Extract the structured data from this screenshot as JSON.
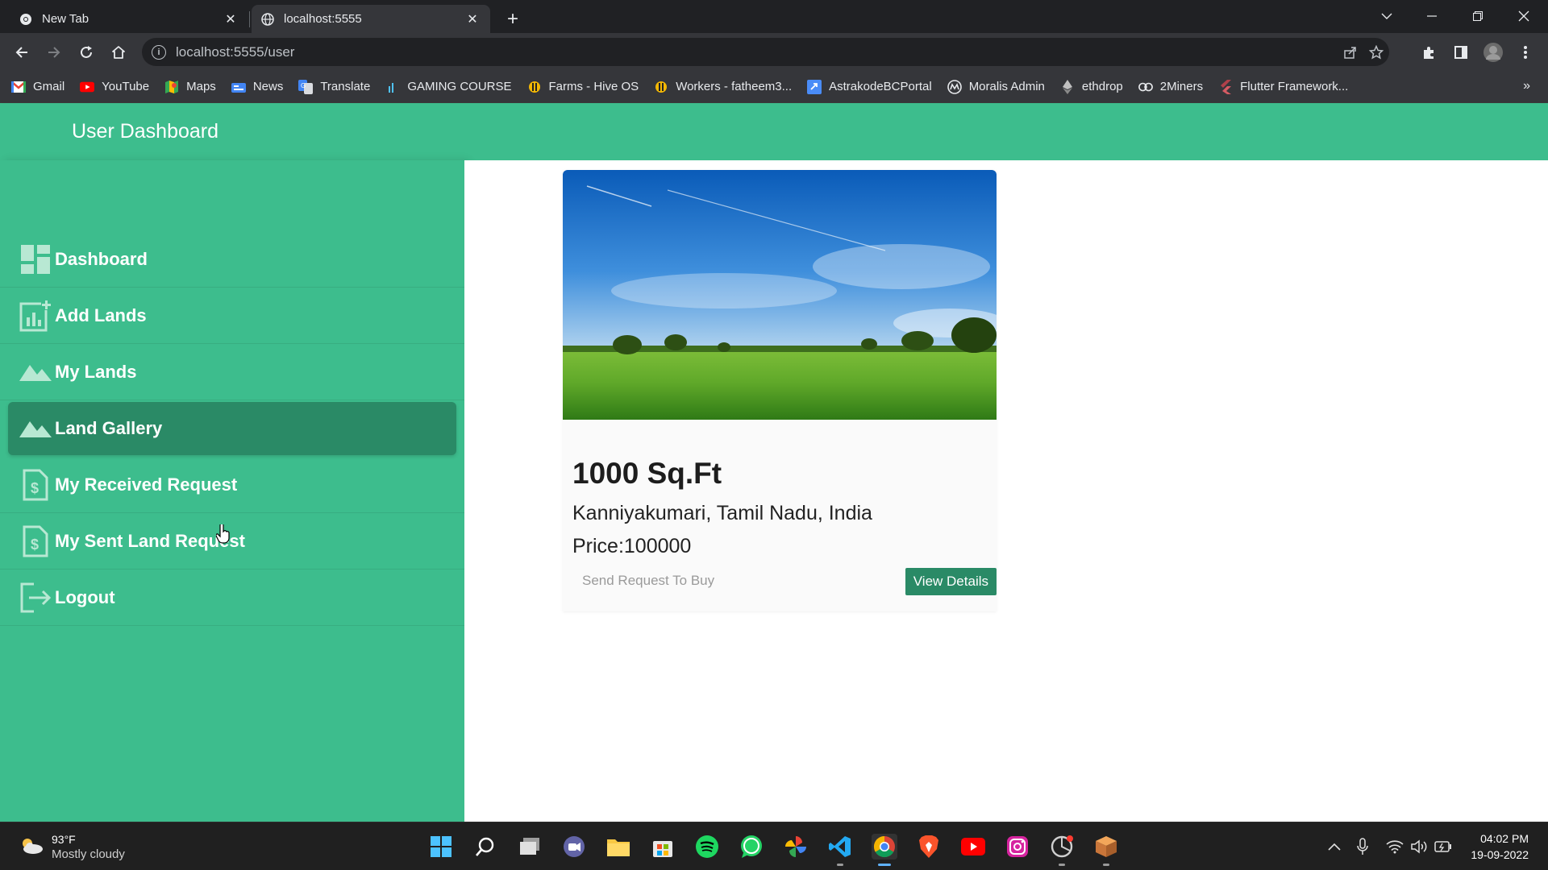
{
  "browser": {
    "tabs": [
      {
        "title": "New Tab",
        "icon": "chrome-icon"
      },
      {
        "title": "localhost:5555",
        "icon": "globe-icon",
        "active": true
      }
    ],
    "url": "localhost:5555/user",
    "bookmarks": [
      {
        "label": "Gmail",
        "icon": "gmail-icon"
      },
      {
        "label": "YouTube",
        "icon": "youtube-icon"
      },
      {
        "label": "Maps",
        "icon": "maps-icon"
      },
      {
        "label": "News",
        "icon": "news-icon"
      },
      {
        "label": "Translate",
        "icon": "translate-icon"
      },
      {
        "label": "GAMING COURSE",
        "icon": "bars-icon"
      },
      {
        "label": "Farms - Hive OS",
        "icon": "hive-icon"
      },
      {
        "label": "Workers - fatheem3...",
        "icon": "hive-icon"
      },
      {
        "label": "AstrakodeBCPortal",
        "icon": "link-icon"
      },
      {
        "label": "Moralis Admin",
        "icon": "moralis-icon"
      },
      {
        "label": "ethdrop",
        "icon": "ethereum-icon"
      },
      {
        "label": "2Miners",
        "icon": "miners-icon"
      },
      {
        "label": "Flutter Framework...",
        "icon": "flutter-icon"
      }
    ],
    "bookmarks_more": "»"
  },
  "app": {
    "title": "User Dashboard",
    "accent": "#3dbd8d",
    "active_color": "#2a8a66"
  },
  "sidebar": {
    "items": [
      {
        "label": "Dashboard",
        "icon": "dashboard-icon"
      },
      {
        "label": "Add Lands",
        "icon": "add-chart-icon"
      },
      {
        "label": "My Lands",
        "icon": "landscape-icon"
      },
      {
        "label": "Land Gallery",
        "icon": "landscape-icon",
        "active": true
      },
      {
        "label": "My Received Request",
        "icon": "document-dollar-icon"
      },
      {
        "label": "My Sent Land Request",
        "icon": "document-dollar-icon"
      },
      {
        "label": "Logout",
        "icon": "logout-icon"
      }
    ]
  },
  "card": {
    "image": "green-field-sky-photo",
    "title": "1000 Sq.Ft",
    "location": "Kanniyakumari, Tamil Nadu, India",
    "price": "Price:100000",
    "request_label": "Send Request To Buy",
    "view_label": "View Details"
  },
  "taskbar": {
    "weather": {
      "temp": "93°F",
      "condition": "Mostly cloudy"
    },
    "time": "04:02 PM",
    "date": "19-09-2022"
  }
}
